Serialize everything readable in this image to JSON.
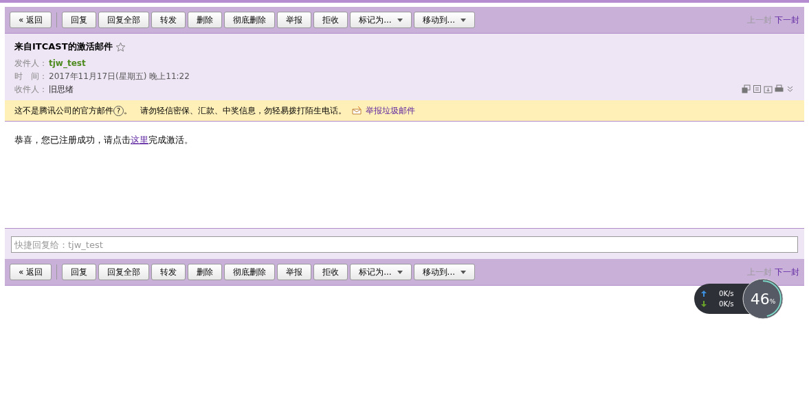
{
  "toolbars": [
    {
      "back": "« 返回",
      "buttons": [
        {
          "label": "回复",
          "kind": "plain"
        },
        {
          "label": "回复全部",
          "kind": "plain"
        },
        {
          "label": "转发",
          "kind": "plain"
        },
        {
          "label": "删除",
          "kind": "plain"
        },
        {
          "label": "彻底删除",
          "kind": "plain"
        },
        {
          "label": "举报",
          "kind": "plain"
        },
        {
          "label": "拒收",
          "kind": "plain"
        },
        {
          "label": "标记为...",
          "kind": "dropdown"
        },
        {
          "label": "移动到...",
          "kind": "dropdown"
        }
      ],
      "prev": {
        "label": "上一封",
        "disabled": true
      },
      "next": {
        "label": "下一封",
        "disabled": false
      }
    },
    {
      "back": "« 返回",
      "buttons": [
        {
          "label": "回复",
          "kind": "plain"
        },
        {
          "label": "回复全部",
          "kind": "plain"
        },
        {
          "label": "转发",
          "kind": "plain"
        },
        {
          "label": "删除",
          "kind": "plain"
        },
        {
          "label": "彻底删除",
          "kind": "plain"
        },
        {
          "label": "举报",
          "kind": "plain"
        },
        {
          "label": "拒收",
          "kind": "plain"
        },
        {
          "label": "标记为...",
          "kind": "dropdown"
        },
        {
          "label": "移动到...",
          "kind": "dropdown"
        }
      ],
      "prev": {
        "label": "上一封",
        "disabled": true
      },
      "next": {
        "label": "下一封",
        "disabled": false
      }
    }
  ],
  "header": {
    "subject": "来自ITCAST的激活邮件",
    "starred": false,
    "sender_label": "发件人：",
    "sender": "tjw_test",
    "time_label": "时　间：",
    "time": "2017年11月17日(星期五) 晚上11:22",
    "recipient_label": "收件人：",
    "recipient": "旧思绪"
  },
  "warning": {
    "text": "这不是腾讯公司的官方邮件",
    "help": "?",
    "suffix": "。",
    "advice": "请勿轻信密保、汇款、中奖信息，勿轻易拨打陌生电话。",
    "report": "举报垃圾邮件"
  },
  "body": {
    "before": "恭喜，您已注册成功，请点击",
    "link": "这里",
    "after": "完成激活。"
  },
  "quick_reply": {
    "placeholder": "快捷回复给：tjw_test"
  },
  "speed_widget": {
    "upload": "0",
    "upload_unit": "K/s",
    "download": "0",
    "download_unit": "K/s",
    "percent": "46",
    "percent_sign": "%",
    "level": 0.46
  }
}
